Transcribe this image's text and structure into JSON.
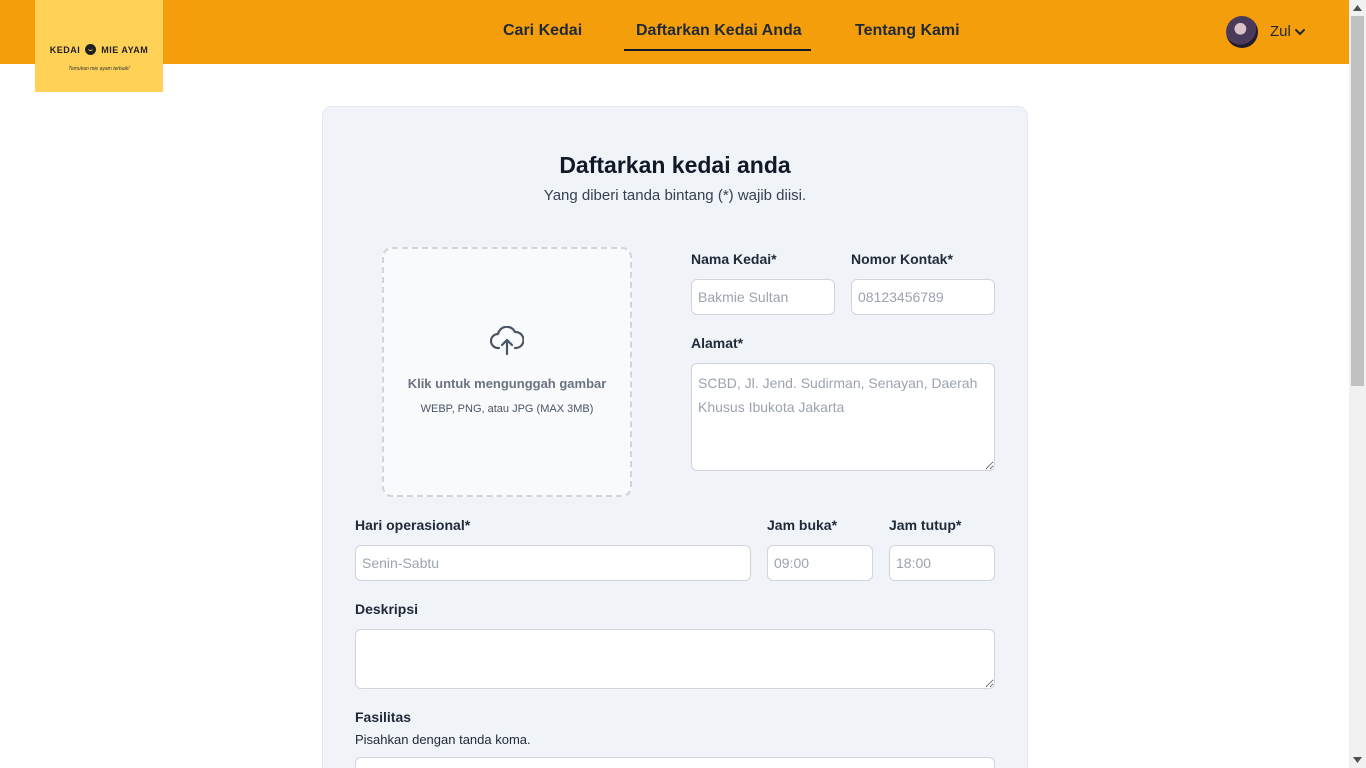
{
  "brand": {
    "name_left": "KEDAI",
    "name_right": "MIE AYAM",
    "tagline": "Temukan mie ayam terbaik!"
  },
  "nav": {
    "items": [
      {
        "label": "Cari Kedai",
        "active": false
      },
      {
        "label": "Daftarkan Kedai Anda",
        "active": true
      },
      {
        "label": "Tentang Kami",
        "active": false
      }
    ]
  },
  "user": {
    "name": "Zul"
  },
  "form": {
    "title": "Daftarkan kedai anda",
    "subtitle": "Yang diberi tanda bintang (*) wajib diisi.",
    "upload": {
      "label": "Klik untuk mengunggah gambar",
      "hint": "WEBP, PNG, atau JPG (MAX 3MB)"
    },
    "nama": {
      "label": "Nama Kedai*",
      "placeholder": "Bakmie Sultan",
      "value": ""
    },
    "kontak": {
      "label": "Nomor Kontak*",
      "placeholder": "08123456789",
      "value": ""
    },
    "alamat": {
      "label": "Alamat*",
      "placeholder": "SCBD, Jl. Jend. Sudirman, Senayan, Daerah Khusus Ibukota Jakarta",
      "value": ""
    },
    "hari": {
      "label": "Hari operasional*",
      "placeholder": "Senin-Sabtu",
      "value": ""
    },
    "buka": {
      "label": "Jam buka*",
      "placeholder": "09:00",
      "value": ""
    },
    "tutup": {
      "label": "Jam tutup*",
      "placeholder": "18:00",
      "value": ""
    },
    "deskripsi": {
      "label": "Deskripsi",
      "placeholder": "",
      "value": ""
    },
    "fasilitas": {
      "label": "Fasilitas",
      "hint": "Pisahkan dengan tanda koma.",
      "placeholder": "",
      "value": ""
    }
  },
  "colors": {
    "header": "#f59e0b",
    "logo_bg": "#ffd257",
    "card_bg": "#f0f3f8"
  },
  "icons": [
    "chevron-down-icon",
    "cloud-upload-icon",
    "bowl-icon"
  ]
}
